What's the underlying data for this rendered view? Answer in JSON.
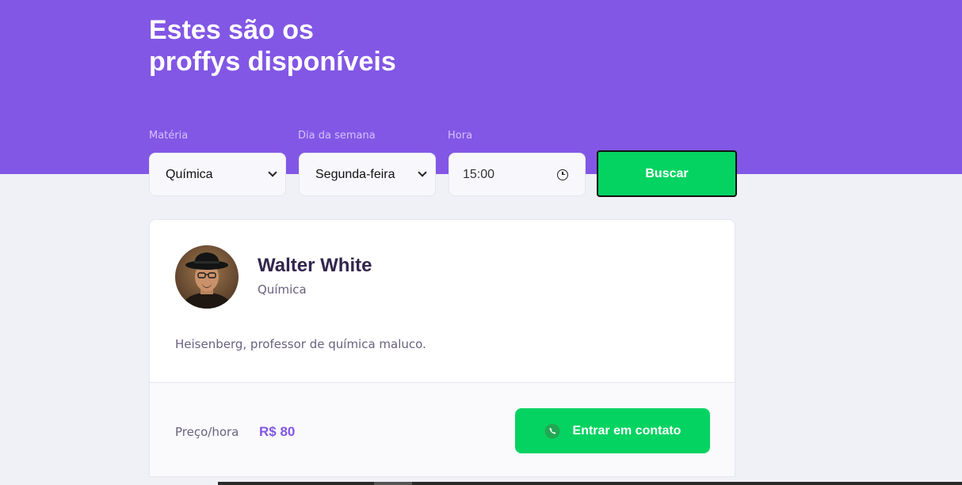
{
  "header": {
    "title_line1": "Estes são os",
    "title_line2": "proffys disponíveis",
    "color": "#8257e5"
  },
  "filters": {
    "subject": {
      "label": "Matéria",
      "value": "Química"
    },
    "weekday": {
      "label": "Dia da semana",
      "value": "Segunda-feira"
    },
    "time": {
      "label": "Hora",
      "value": "15:00"
    },
    "search_label": "Buscar"
  },
  "teacher": {
    "name": "Walter White",
    "subject": "Química",
    "bio": "Heisenberg, professor de química maluco.",
    "price_label": "Preço/hora",
    "price_value": "R$ 80",
    "contact_label": "Entrar em contato",
    "avatar_icon": "user-photo"
  },
  "colors": {
    "accent": "#8257e5",
    "button_green": "#04d361",
    "text_title": "#32264d",
    "text_body": "#6a6180"
  }
}
